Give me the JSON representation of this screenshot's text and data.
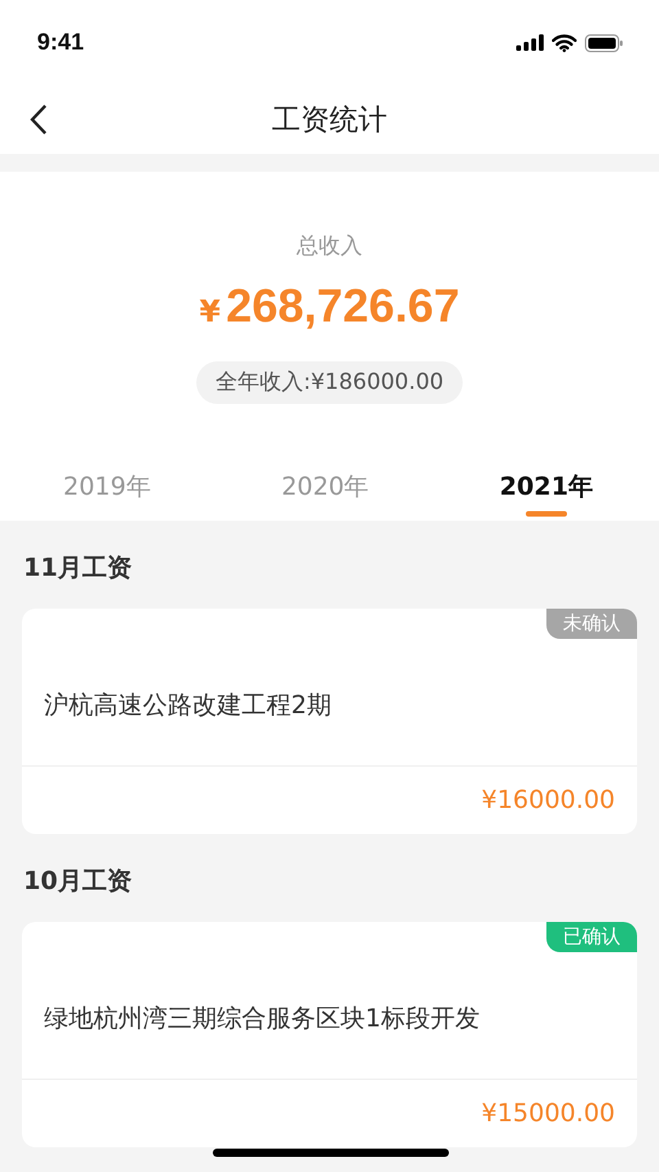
{
  "status_bar": {
    "time": "9:41"
  },
  "nav": {
    "title": "工资统计"
  },
  "summary": {
    "label": "总收入",
    "currency": "¥",
    "amount": "268,726.67",
    "year_income": "全年收入:¥186000.00"
  },
  "years": [
    {
      "label": "2019年",
      "selected": false
    },
    {
      "label": "2020年",
      "selected": false
    },
    {
      "label": "2021年",
      "selected": true
    }
  ],
  "months": [
    {
      "title": "11月工资",
      "project": "沪杭高速公路改建工程2期",
      "status": "未确认",
      "confirmed": false,
      "amount": "¥16000.00"
    },
    {
      "title": "10月工资",
      "project": "绿地杭州湾三期综合服务区块1标段开发",
      "status": "已确认",
      "confirmed": true,
      "amount": "¥15000.00"
    }
  ]
}
